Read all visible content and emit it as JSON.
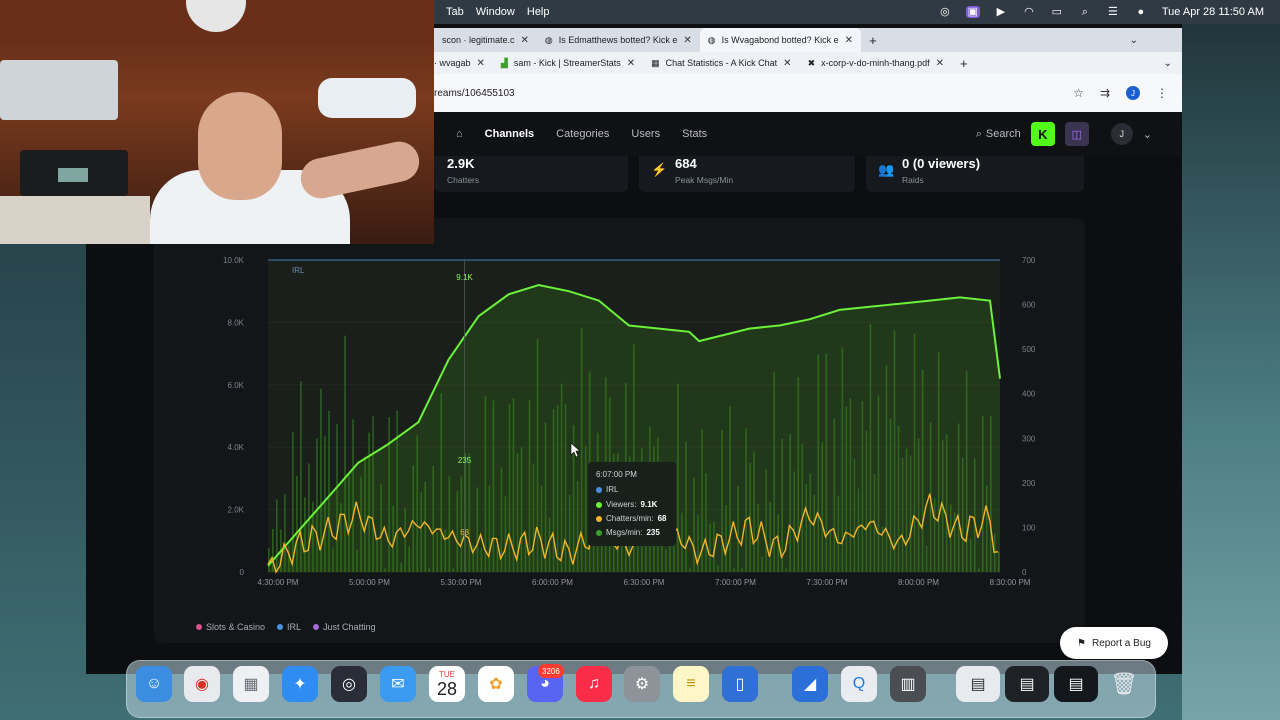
{
  "menubar": {
    "items": [
      "Tab",
      "Window",
      "Help"
    ],
    "datetime": "Tue Apr 28  11:50 AM"
  },
  "tabs_row1": [
    {
      "label": "scon · legitimate.c",
      "active": false
    },
    {
      "label": "Is Edmatthews botted? Kick e",
      "active": false
    },
    {
      "label": "Is Wvagabond botted? Kick e",
      "active": true
    }
  ],
  "tabs_row2": [
    {
      "label": "· wvagab"
    },
    {
      "label": "sam - Kick | StreamerStats"
    },
    {
      "label": "Chat Statistics - A Kick Chat"
    },
    {
      "label": "x-corp-v-do-minh-thang.pdf"
    }
  ],
  "address": {
    "url": "reams/106455103"
  },
  "nav": {
    "items": [
      "Channels",
      "Categories",
      "Users",
      "Stats"
    ],
    "active": "Channels",
    "search_label": "Search",
    "user_initial": "J"
  },
  "stats": [
    {
      "value": "2.9K",
      "label": "Chatters",
      "icon": "chat-icon"
    },
    {
      "value": "684",
      "label": "Peak Msgs/Min",
      "icon": "lightning-icon"
    },
    {
      "value": "0 (0 viewers)",
      "label": "Raids",
      "icon": "users-icon"
    }
  ],
  "chart_data": {
    "type": "line",
    "x": [
      "4:30:00 PM",
      "5:00:00 PM",
      "5:30:00 PM",
      "6:00:00 PM",
      "6:30:00 PM",
      "7:00:00 PM",
      "7:30:00 PM",
      "8:00:00 PM",
      "8:30:00 PM"
    ],
    "x_minutes": [
      0,
      15,
      30,
      45,
      60,
      75,
      90,
      105,
      120,
      135,
      150,
      165,
      180,
      195,
      210,
      215,
      240,
      255,
      270,
      285,
      300,
      315,
      330,
      345,
      360,
      365
    ],
    "y_left_ticks": [
      "0",
      "2.0K",
      "4.0K",
      "6.0K",
      "8.0K",
      "10.0K"
    ],
    "y_left_range": [
      0,
      10000
    ],
    "y_right_ticks": [
      "0",
      "100",
      "200",
      "300",
      "400",
      "500",
      "600",
      "700"
    ],
    "y_right_range": [
      0,
      700
    ],
    "category_band": "IRL",
    "series": [
      {
        "name": "Viewers",
        "axis": "left",
        "color": "#6cf23a",
        "values": [
          200,
          1300,
          2400,
          3500,
          4100,
          4800,
          6800,
          8200,
          8900,
          9200,
          9000,
          8700,
          7900,
          7800,
          7700,
          7400,
          7800,
          7900,
          8100,
          8400,
          8500,
          8600,
          8700,
          8800,
          8700,
          6200
        ]
      },
      {
        "name": "Chatters/min",
        "axis": "right",
        "color": "#f2b52a",
        "values": [
          5,
          60,
          90,
          130,
          70,
          110,
          80,
          60,
          55,
          70,
          40,
          90,
          50,
          110,
          60,
          40,
          100,
          50,
          130,
          70,
          110,
          60,
          150,
          90,
          120,
          5
        ]
      },
      {
        "name": "Msgs/min",
        "axis": "right",
        "color": "#2f6a1f",
        "values": [
          40,
          200,
          260,
          280,
          240,
          260,
          230,
          220,
          250,
          235,
          250,
          240,
          260,
          230,
          250,
          240,
          260,
          250,
          270,
          260,
          250,
          280,
          260,
          270,
          250,
          100
        ]
      }
    ],
    "tooltip": {
      "time": "6:07:00 PM",
      "category": "IRL",
      "rows": [
        {
          "label": "Viewers:",
          "value": "9.1K",
          "color": "#6cf23a"
        },
        {
          "label": "Chatters/min:",
          "value": "68",
          "color": "#f2b52a"
        },
        {
          "label": "Msgs/min:",
          "value": "235",
          "color": "#3aa02a"
        }
      ]
    },
    "peak_label": "9.1K",
    "hover_label": "235",
    "chatters_hover_label": "68"
  },
  "legend": [
    {
      "label": "Slots & Casino",
      "color": "#d9508a"
    },
    {
      "label": "IRL",
      "color": "#4a90e2"
    },
    {
      "label": "Just Chatting",
      "color": "#a66bd8"
    }
  ],
  "report_bug": "Report a Bug",
  "dock": {
    "calendar_month": "TUE",
    "calendar_day": "28",
    "discord_badge": "3206"
  }
}
